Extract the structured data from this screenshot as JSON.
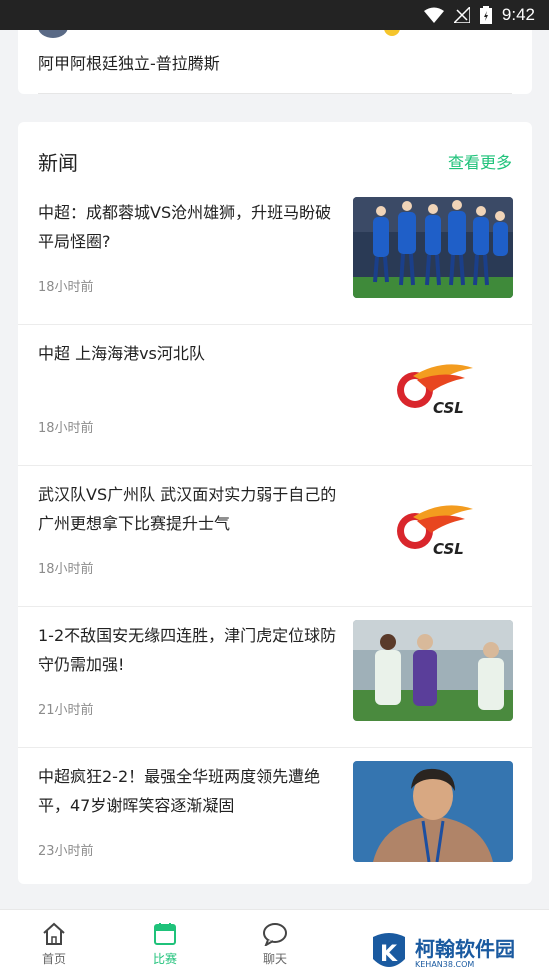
{
  "status": {
    "time": "9:42"
  },
  "match": {
    "title": "阿甲阿根廷独立-普拉腾斯"
  },
  "news": {
    "title": "新闻",
    "see_more": "查看更多",
    "items": [
      {
        "headline": "中超：成都蓉城VS沧州雄狮，升班马盼破平局怪圈?",
        "time": "18小时前",
        "thumb": "team-celebration-photo"
      },
      {
        "headline": "中超 上海海港vs河北队",
        "time": "18小时前",
        "thumb": "csl-logo"
      },
      {
        "headline": "武汉队VS广州队 武汉面对实力弱于自己的广州更想拿下比赛提升士气",
        "time": "18小时前",
        "thumb": "csl-logo"
      },
      {
        "headline": "1-2不敌国安无缘四连胜，津门虎定位球防守仍需加强!",
        "time": "21小时前",
        "thumb": "players-match-photo"
      },
      {
        "headline": "中超疯狂2-2！最强全华班两度领先遭绝平，47岁谢晖笑容逐渐凝固",
        "time": "23小时前",
        "thumb": "coach-portrait-photo"
      }
    ]
  },
  "nav": {
    "home": "首页",
    "match": "比赛",
    "chat": "聊天"
  },
  "logo": {
    "csl_text": "CSL"
  },
  "watermark": {
    "title": "柯翰软件园",
    "sub": "KEHAN38.COM",
    "letter": "K"
  },
  "colors": {
    "accent": "#1fc27a",
    "status_bar": "#232323"
  }
}
